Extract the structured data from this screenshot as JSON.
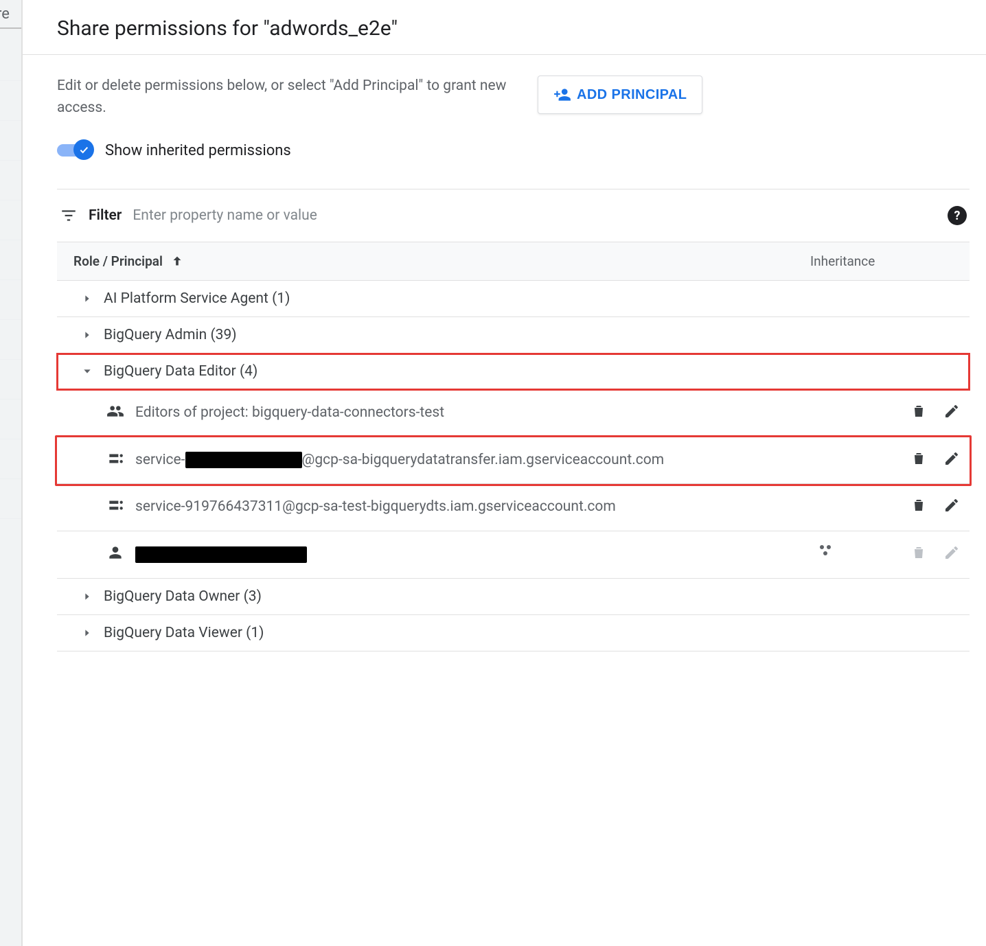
{
  "title": "Share permissions for \"adwords_e2e\"",
  "intro": "Edit or delete permissions below, or select \"Add Principal\" to grant new access.",
  "add_principal_label": "ADD PRINCIPAL",
  "toggle_label": "Show inherited permissions",
  "filter": {
    "label": "Filter",
    "placeholder": "Enter property name or value"
  },
  "columns": {
    "role": "Role / Principal",
    "inheritance": "Inheritance"
  },
  "roles": [
    {
      "name": "AI Platform Service Agent",
      "count": 1,
      "expanded": false
    },
    {
      "name": "BigQuery Admin",
      "count": 39,
      "expanded": false
    },
    {
      "name": "BigQuery Data Editor",
      "count": 4,
      "expanded": true,
      "highlighted": true,
      "children": [
        {
          "icon": "group",
          "text_prefix": "Editors of project: bigquery-data-connectors-test",
          "text_suffix": "",
          "redacted_middle": false,
          "inherited": false
        },
        {
          "icon": "service-account",
          "text_prefix": "service-",
          "text_suffix": "@gcp-sa-bigquerydatatransfer.iam.gserviceaccount.com",
          "redacted_middle": true,
          "redacted_width": 170,
          "inherited": false,
          "highlighted": true
        },
        {
          "icon": "service-account",
          "text_prefix": "service-919766437311@gcp-sa-test-bigquerydts.iam.gserviceaccount.com",
          "text_suffix": "",
          "redacted_middle": false,
          "inherited": false
        },
        {
          "icon": "user",
          "text_prefix": "",
          "text_suffix": "",
          "redacted_middle": true,
          "redacted_width": 250,
          "inherited": true,
          "actions_disabled": true
        }
      ]
    },
    {
      "name": "BigQuery Data Owner",
      "count": 3,
      "expanded": false
    },
    {
      "name": "BigQuery Data Viewer",
      "count": 1,
      "expanded": false
    }
  ],
  "left_fragment": "re"
}
